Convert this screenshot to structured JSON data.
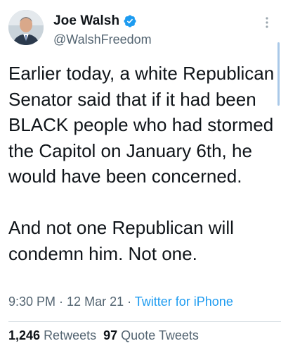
{
  "author": {
    "display_name": "Joe Walsh",
    "handle": "@WalshFreedom",
    "verified": true
  },
  "icons": {
    "verified": "verified-badge-icon",
    "more": "more-vertical-icon",
    "avatar": "avatar"
  },
  "colors": {
    "accent": "#1d9bf0",
    "text": "#0f1419",
    "muted": "#536471"
  },
  "tweet": {
    "text": "Earlier today, a white Republican Senator said that if it had been BLACK people who had stormed the Capitol on January 6th, he would have been concerned.\n\nAnd not one Republican will condemn him. Not one."
  },
  "meta": {
    "time": "9:30 PM",
    "separator": " · ",
    "date": "12 Mar 21",
    "separator2": " · ",
    "source": "Twitter for iPhone"
  },
  "stats": {
    "retweets_count": "1,246",
    "retweets_label": "Retweets",
    "quotes_count": "97",
    "quotes_label": "Quote Tweets"
  }
}
